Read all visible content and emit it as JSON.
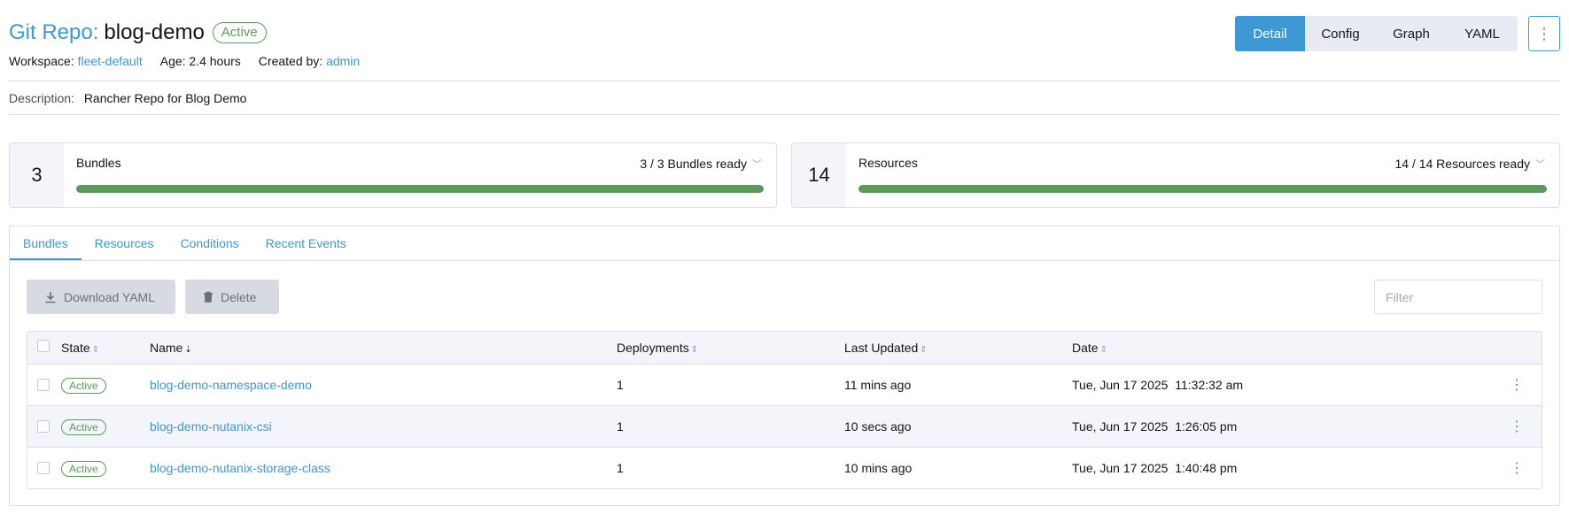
{
  "header": {
    "title_prefix": "Git Repo:",
    "title_name": "blog-demo",
    "state": "Active",
    "workspace_label": "Workspace:",
    "workspace_value": "fleet-default",
    "age": "Age: 2.4 hours",
    "created_by_label": "Created by:",
    "created_by_value": "admin"
  },
  "view_buttons": [
    "Detail",
    "Config",
    "Graph",
    "YAML"
  ],
  "active_view": "Detail",
  "kebab_icon": "⋮",
  "description": {
    "label": "Description:",
    "value": "Rancher Repo for Blog Demo"
  },
  "counts": {
    "bundles": {
      "count": "3",
      "title": "Bundles",
      "ready": "3 / 3 Bundles ready",
      "ready_fraction": 1.0
    },
    "resources": {
      "count": "14",
      "title": "Resources",
      "ready": "14 / 14 Resources ready",
      "ready_fraction": 1.0
    }
  },
  "tabs": [
    "Bundles",
    "Resources",
    "Conditions",
    "Recent Events"
  ],
  "active_tab": "Bundles",
  "actions": {
    "download_label": "Download YAML",
    "download_icon": "download-icon",
    "delete_label": "Delete",
    "delete_icon": "trash-icon"
  },
  "filter": {
    "placeholder": "Filter"
  },
  "table": {
    "headers": {
      "state": "State",
      "name": "Name",
      "deployments": "Deployments",
      "last_updated": "Last Updated",
      "date": "Date"
    },
    "rows": [
      {
        "state": "Active",
        "name": "blog-demo-namespace-demo",
        "deployments": "1",
        "last_updated": "11 mins ago",
        "date": "Tue, Jun 17 2025  11:32:32 am"
      },
      {
        "state": "Active",
        "name": "blog-demo-nutanix-csi",
        "deployments": "1",
        "last_updated": "10 secs ago",
        "date": "Tue, Jun 17 2025  1:26:05 pm"
      },
      {
        "state": "Active",
        "name": "blog-demo-nutanix-storage-class",
        "deployments": "1",
        "last_updated": "10 mins ago",
        "date": "Tue, Jun 17 2025  1:40:48 pm"
      }
    ]
  },
  "colors": {
    "accent": "#3d98d3",
    "success": "#5d995d",
    "muted_bg": "#f4f5fa"
  }
}
